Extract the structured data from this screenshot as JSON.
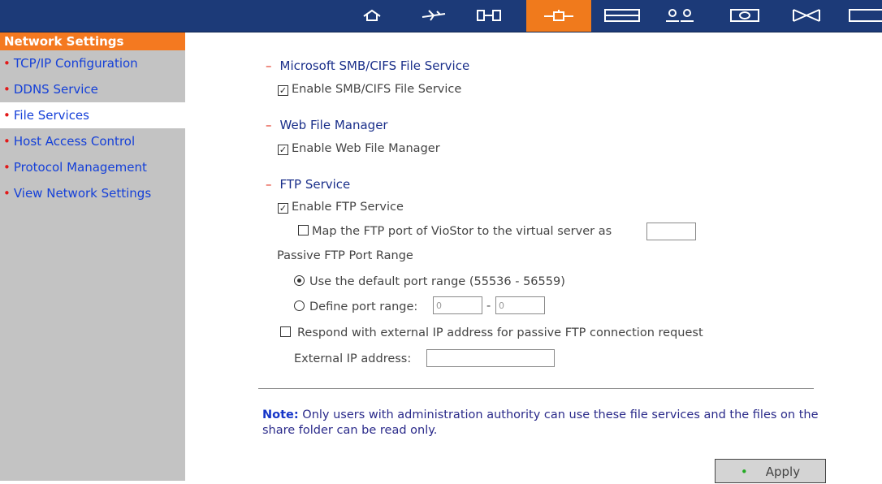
{
  "topbar": {
    "icons": [
      {
        "name": "home-icon"
      },
      {
        "name": "plane-icon"
      },
      {
        "name": "system-settings-icon"
      },
      {
        "name": "network-icon"
      },
      {
        "name": "disk-icon"
      },
      {
        "name": "users-icon"
      },
      {
        "name": "monitor-icon"
      },
      {
        "name": "hourglass-icon"
      },
      {
        "name": "window-icon"
      }
    ],
    "active_index": 3,
    "colors": {
      "bar": "#1c3a78",
      "active": "#f07a1c"
    }
  },
  "sidebar": {
    "title": "Network Settings",
    "items": [
      {
        "label": "TCP/IP Configuration"
      },
      {
        "label": "DDNS Service"
      },
      {
        "label": "File Services"
      },
      {
        "label": "Host Access Control"
      },
      {
        "label": "Protocol Management"
      },
      {
        "label": "View Network Settings"
      }
    ],
    "active_index": 2
  },
  "smb": {
    "title": "Microsoft SMB/CIFS File Service",
    "enable_label": "Enable SMB/CIFS File Service",
    "enabled": true
  },
  "webfm": {
    "title": "Web File Manager",
    "enable_label": "Enable Web File Manager",
    "enabled": true
  },
  "ftp": {
    "title": "FTP Service",
    "enable_label": "Enable FTP Service",
    "enabled": true,
    "map_label": "Map the FTP port of VioStor to the virtual server as",
    "map_checked": false,
    "map_value": "",
    "passive_title": "Passive FTP Port Range",
    "default_range_label": "Use the default port range (55536 - 56559)",
    "default_range_selected": true,
    "define_range_label": "Define port range:",
    "range_from": "0",
    "range_sep": "-",
    "range_to": "0",
    "respond_label": "Respond with external IP address for passive FTP connection request",
    "respond_checked": false,
    "external_ip_label": "External IP address:",
    "external_ip_value": ""
  },
  "note": {
    "label": "Note:",
    "text": "Only users with administration authority can use these file services and the files on the share folder can be read only."
  },
  "apply_label": "Apply"
}
